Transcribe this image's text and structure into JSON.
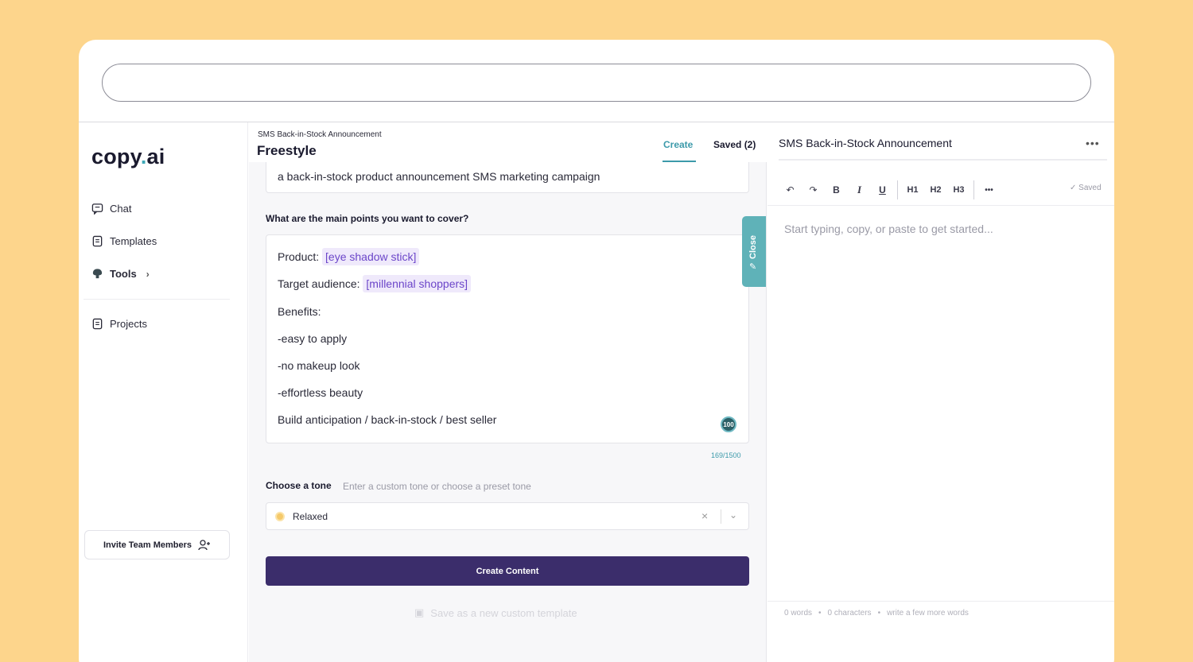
{
  "sidebar": {
    "logo_main": "copy",
    "logo_dot": ".",
    "logo_suffix": "ai",
    "items": [
      {
        "label": "Chat",
        "icon": "chat-icon"
      },
      {
        "label": "Templates",
        "icon": "document-icon"
      },
      {
        "label": "Tools",
        "icon": "tools-icon"
      },
      {
        "label": "Projects",
        "icon": "folder-icon"
      }
    ],
    "invite_label": "Invite Team Members"
  },
  "middle": {
    "breadcrumb": "SMS Back-in-Stock Announcement",
    "title": "Freestyle",
    "tabs": {
      "create": "Create",
      "saved": "Saved (2)"
    },
    "description": "a back-in-stock product announcement SMS marketing campaign",
    "points_label": "What are the main points you want to cover?",
    "points": {
      "product_prefix": "Product:",
      "product_value": "[eye shadow stick]",
      "audience_prefix": "Target audience:",
      "audience_value": "[millennial shoppers]",
      "benefits": "Benefits:",
      "b1": "-easy to apply",
      "b2": "-no makeup look",
      "b3": "-effortless beauty",
      "closing": "Build anticipation / back-in-stock / best seller"
    },
    "badge": "100",
    "char_count": "169/1500",
    "tone_label": "Choose a tone",
    "tone_hint": "Enter a custom tone or choose a preset tone",
    "tone_value": "Relaxed",
    "create_button": "Create Content",
    "save_template": "Save as a new custom template",
    "close_tab": "Close"
  },
  "editor": {
    "title": "SMS Back-in-Stock Announcement",
    "more": "•••",
    "toolbar": [
      "↶",
      "↷",
      "B",
      "I",
      "U",
      "H1",
      "H2",
      "H3",
      "•••"
    ],
    "saved": "✓ Saved",
    "placeholder": "Start typing, copy, or paste to get started...",
    "stats": {
      "words": "0 words",
      "characters": "0 characters",
      "hint": "write a few more words"
    }
  },
  "colors": {
    "accent": "#3c9aaa",
    "primary_button": "#3b2d6b",
    "background": "#FDD58C",
    "chip_text": "#6b45c9"
  }
}
